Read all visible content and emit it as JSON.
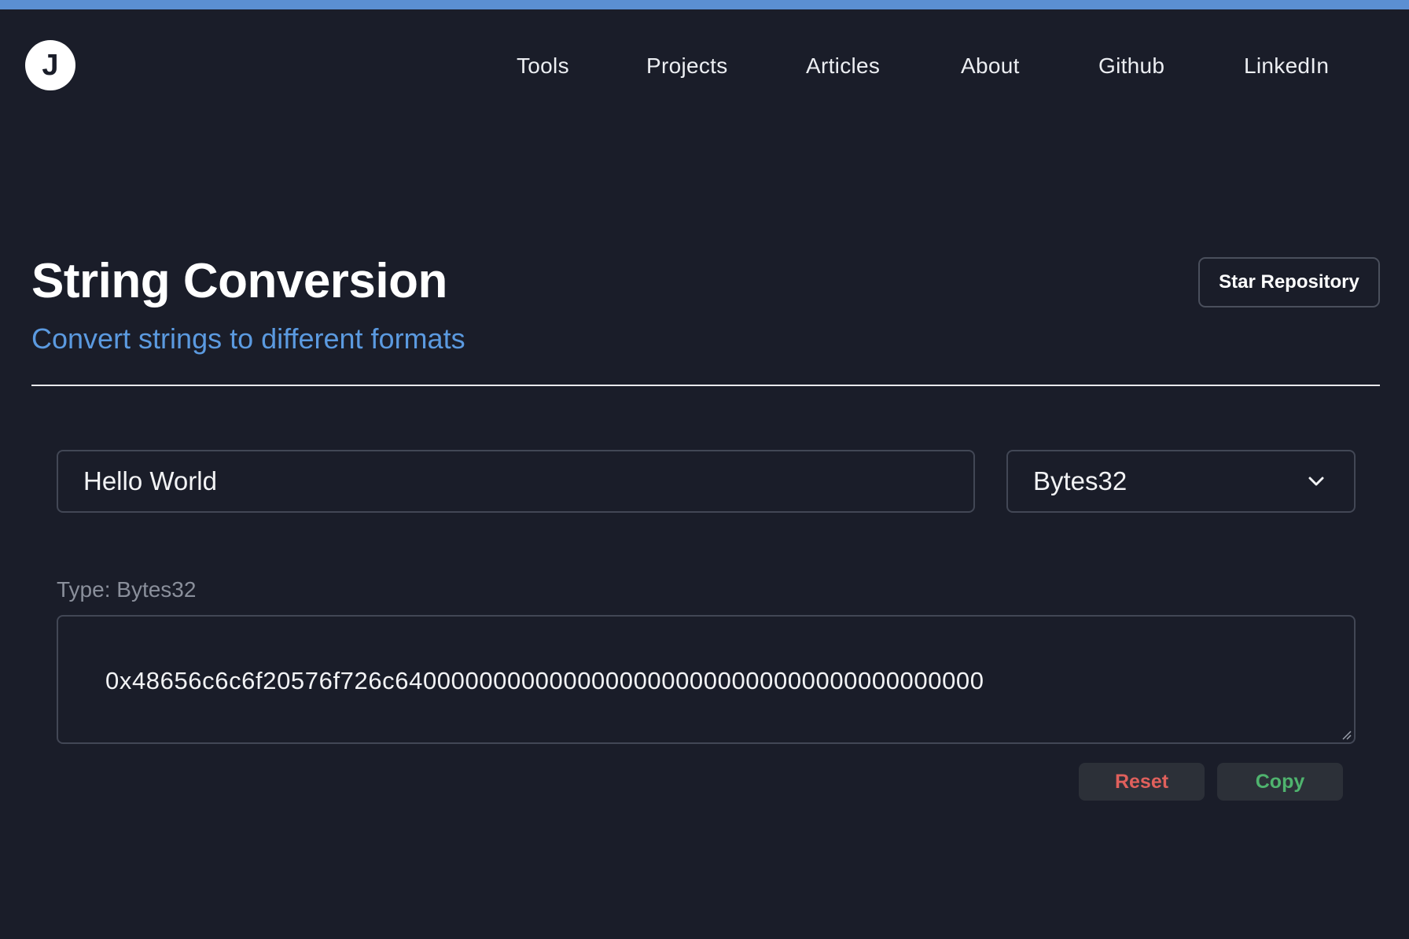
{
  "colors": {
    "background": "#1a1d29",
    "accent_bar": "#5b8fd2",
    "subtitle": "#5b9ae0",
    "reset": "#e0605c",
    "copy": "#4fb36e"
  },
  "logo": {
    "letter": "J"
  },
  "nav": {
    "links": [
      "Tools",
      "Projects",
      "Articles",
      "About",
      "Github",
      "LinkedIn"
    ]
  },
  "header": {
    "title": "String Conversion",
    "subtitle": "Convert strings to different formats",
    "star_button": "Star Repository"
  },
  "converter": {
    "input_value": "Hello World",
    "format_selected": "Bytes32",
    "type_label": "Type: Bytes32",
    "output_value": "0x48656c6c6f20576f726c640000000000000000000000000000000000000000",
    "reset_label": "Reset",
    "copy_label": "Copy",
    "icons": {
      "select": "chevron-down-icon",
      "resize": "resize-grip-icon"
    }
  }
}
